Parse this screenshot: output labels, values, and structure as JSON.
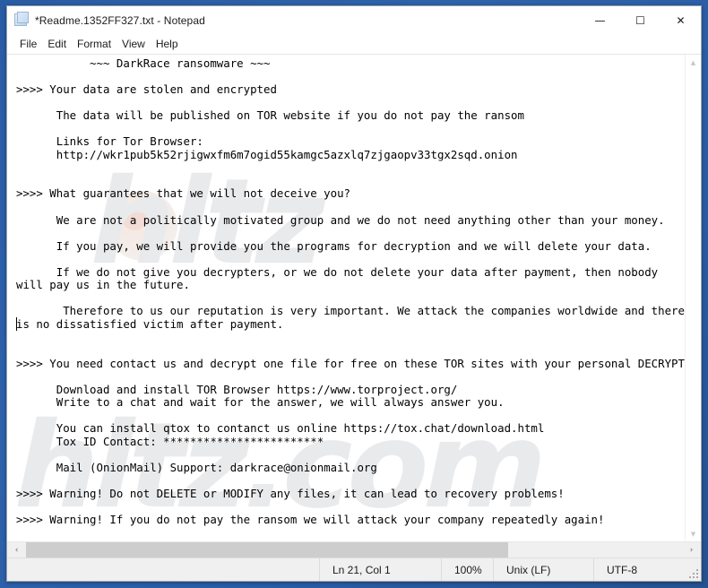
{
  "window": {
    "title": "*Readme.1352FF327.txt - Notepad",
    "icon": "notepad-document-icon",
    "controls": {
      "minimize": "—",
      "maximize": "☐",
      "close": "✕"
    }
  },
  "menubar": {
    "items": [
      {
        "label": "File"
      },
      {
        "label": "Edit"
      },
      {
        "label": "Format"
      },
      {
        "label": "View"
      },
      {
        "label": "Help"
      }
    ]
  },
  "editor": {
    "watermark_text_1": "hltz",
    "watermark_text_2": "hltz.com",
    "lines": [
      "           ~~~ DarkRace ransomware ~~~",
      "",
      ">>>> Your data are stolen and encrypted",
      "",
      "      The data will be published on TOR website if you do not pay the ransom",
      "",
      "      Links for Tor Browser:",
      "      http://wkr1pub5k52rjigwxfm6m7ogid55kamgc5azxlq7zjgaopv33tgx2sqd.onion",
      "",
      "",
      ">>>> What guarantees that we will not deceive you?",
      "",
      "      We are not a politically motivated group and we do not need anything other than your money.",
      "",
      "      If you pay, we will provide you the programs for decryption and we will delete your data.",
      "",
      "      If we do not give you decrypters, or we do not delete your data after payment, then nobody",
      "will pay us in the future.",
      "",
      "       Therefore to us our reputation is very important. We attack the companies worldwide and there",
      "is no dissatisfied victim after payment.",
      "",
      "",
      ">>>> You need contact us and decrypt one file for free on these TOR sites with your personal DECRYPTION ID",
      "",
      "      Download and install TOR Browser https://www.torproject.org/",
      "      Write to a chat and wait for the answer, we will always answer you.",
      "",
      "      You can install qtox to contanct us online https://tox.chat/download.html",
      "      Tox ID Contact: ************************",
      "",
      "      Mail (OnionMail) Support: darkrace@onionmail.org",
      "",
      ">>>> Warning! Do not DELETE or MODIFY any files, it can lead to recovery problems!",
      "",
      ">>>> Warning! If you do not pay the ransom we will attack your company repeatedly again!"
    ]
  },
  "scrollbars": {
    "vertical_up_arrow": "▲",
    "vertical_down_arrow": "▼",
    "horizontal_left_arrow": "‹",
    "horizontal_right_arrow": "›"
  },
  "statusbar": {
    "line_col": "Ln 21, Col 1",
    "zoom": "100%",
    "line_ending": "Unix (LF)",
    "encoding": "UTF-8"
  }
}
